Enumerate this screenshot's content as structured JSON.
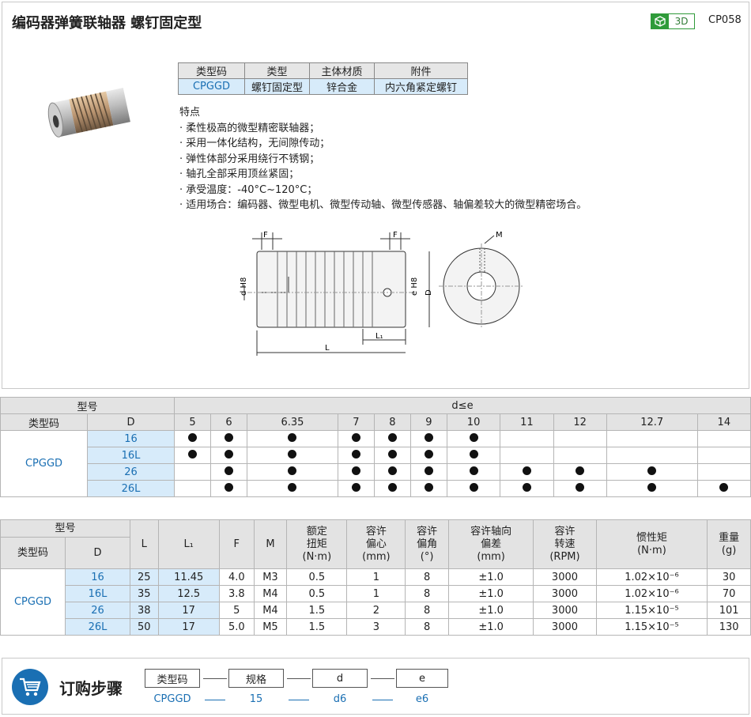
{
  "header": {
    "title": "编码器弹簧联轴器  螺钉固定型",
    "badge_3d": "3D",
    "code": "CP058"
  },
  "spec_table": {
    "headers": [
      "类型码",
      "类型",
      "主体材质",
      "附件"
    ],
    "row": [
      "CPGGD",
      "螺钉固定型",
      "锌合金",
      "内六角紧定螺钉"
    ]
  },
  "features": {
    "title": "特点",
    "items": [
      "· 柔性极高的微型精密联轴器；",
      "· 采用一体化结构，无间隙传动；",
      "· 弹性体部分采用绕行不锈钢；",
      "· 轴孔全部采用顶丝紧固；",
      "· 承受温度：-40°C~120°C；",
      "· 适用场合：编码器、微型电机、微型传动轴、微型传感器、轴偏差较大的微型精密场合。"
    ]
  },
  "drawing_labels": {
    "f1": "F",
    "f2": "F",
    "m": "M",
    "d1": "d H8",
    "d2": "e H8",
    "D": "D",
    "L1": "L₁",
    "L": "L"
  },
  "compat": {
    "h_model": "型号",
    "h_range": "d≤e",
    "h_type": "类型码",
    "h_D": "D",
    "type": "CPGGD",
    "sizes": [
      "5",
      "6",
      "6.35",
      "7",
      "8",
      "9",
      "10",
      "11",
      "12",
      "12.7",
      "14"
    ],
    "rows": [
      {
        "D": "16",
        "marks": [
          1,
          1,
          1,
          1,
          1,
          1,
          1,
          0,
          0,
          0,
          0
        ]
      },
      {
        "D": "16L",
        "marks": [
          1,
          1,
          1,
          1,
          1,
          1,
          1,
          0,
          0,
          0,
          0
        ]
      },
      {
        "D": "26",
        "marks": [
          0,
          1,
          1,
          1,
          1,
          1,
          1,
          1,
          1,
          1,
          0
        ]
      },
      {
        "D": "26L",
        "marks": [
          0,
          1,
          1,
          1,
          1,
          1,
          1,
          1,
          1,
          1,
          1
        ]
      }
    ]
  },
  "dims": {
    "h_model": "型号",
    "h_type": "类型码",
    "h_D": "D",
    "cols": [
      "L",
      "L₁",
      "F",
      "M",
      "额定\n扭矩\n(N·m)",
      "容许\n偏心\n(mm)",
      "容许\n偏角\n(°)",
      "容许轴向\n偏差\n(mm)",
      "容许\n转速\n(RPM)",
      "惯性矩\n(N·m)",
      "重量\n(g)"
    ],
    "type": "CPGGD",
    "rows": [
      {
        "D": "16",
        "vals": [
          "25",
          "11.45",
          "4.0",
          "M3",
          "0.5",
          "1",
          "8",
          "±1.0",
          "3000",
          "1.02×10⁻⁶",
          "30"
        ]
      },
      {
        "D": "16L",
        "vals": [
          "35",
          "12.5",
          "3.8",
          "M4",
          "0.5",
          "1",
          "8",
          "±1.0",
          "3000",
          "1.02×10⁻⁶",
          "70"
        ]
      },
      {
        "D": "26",
        "vals": [
          "38",
          "17",
          "5",
          "M4",
          "1.5",
          "2",
          "8",
          "±1.0",
          "3000",
          "1.15×10⁻⁵",
          "101"
        ]
      },
      {
        "D": "26L",
        "vals": [
          "50",
          "17",
          "5.0",
          "M5",
          "1.5",
          "3",
          "8",
          "±1.0",
          "3000",
          "1.15×10⁻⁵",
          "130"
        ]
      }
    ]
  },
  "order": {
    "label": "订购步骤",
    "boxes": [
      "类型码",
      "规格",
      "d",
      "e"
    ],
    "values": [
      "CPGGD",
      "15",
      "d6",
      "e6"
    ]
  },
  "colors": {
    "accent": "#1a6fb3",
    "badge_green": "#2f9b3a",
    "cell_blue": "#d7ebfa",
    "header_gray": "#e3e3e3"
  }
}
